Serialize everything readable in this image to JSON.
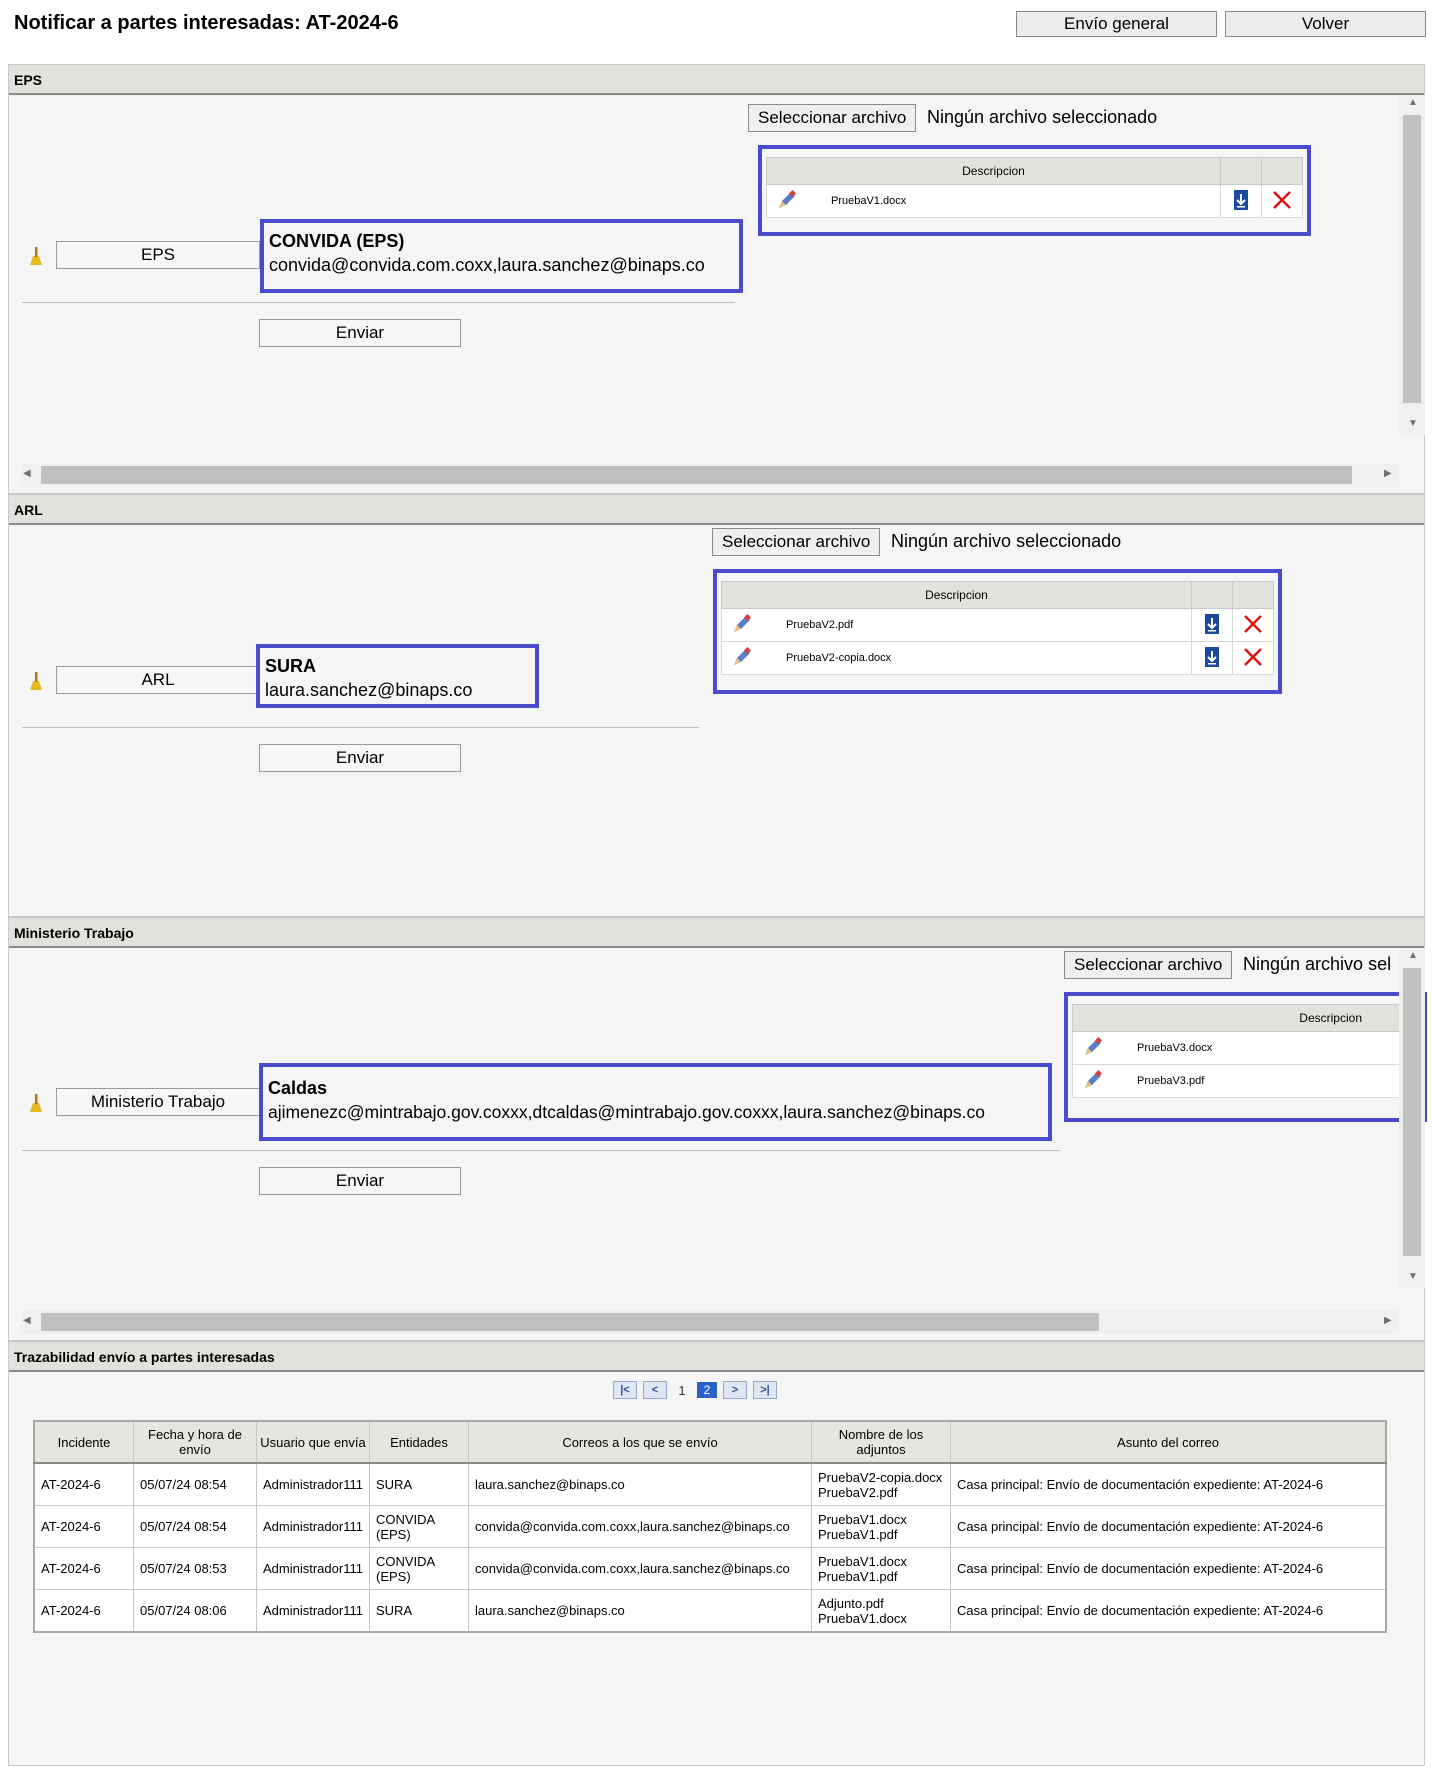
{
  "page": {
    "title": "Notificar a partes interesadas: AT-2024-6"
  },
  "toolbar": {
    "general_label": "Envío general",
    "back_label": "Volver"
  },
  "common": {
    "select_file_label": "Seleccionar archivo",
    "no_file_label": "Ningún archivo seleccionado",
    "no_file_truncated": "Ningún archivo sel",
    "send_label": "Enviar",
    "description_header": "Descripcion"
  },
  "sections": {
    "eps": {
      "header": "EPS",
      "entity_button": "EPS",
      "recipient_name": "CONVIDA (EPS)",
      "recipient_emails": "convida@convida.com.coxx,laura.sanchez@binaps.co",
      "files": [
        "PruebaV1.docx"
      ]
    },
    "arl": {
      "header": "ARL",
      "entity_button": "ARL",
      "recipient_name": "SURA",
      "recipient_emails": "laura.sanchez@binaps.co",
      "files": [
        "PruebaV2.pdf",
        "PruebaV2-copia.docx"
      ]
    },
    "ministerio": {
      "header": "Ministerio Trabajo",
      "entity_button": "Ministerio Trabajo",
      "recipient_name": "Caldas",
      "recipient_emails": "ajimenezc@mintrabajo.gov.coxxx,dtcaldas@mintrabajo.gov.coxxx,laura.sanchez@binaps.co",
      "files": [
        "PruebaV3.docx",
        "PruebaV3.pdf"
      ]
    }
  },
  "trace": {
    "header": "Trazabilidad envío a partes interesadas",
    "pager": {
      "page_1": "1",
      "page_2": "2"
    },
    "columns": [
      "Incidente",
      "Fecha y hora de envío",
      "Usuario que envía",
      "Entidades",
      "Correos a los que se envío",
      "Nombre de los adjuntos",
      "Asunto del correo"
    ],
    "rows": [
      [
        "AT-2024-6",
        "05/07/24 08:54",
        "Administrador111",
        "SURA",
        "laura.sanchez@binaps.co",
        "PruebaV2-copia.docx PruebaV2.pdf",
        "Casa principal: Envío de documentación expediente: AT-2024-6"
      ],
      [
        "AT-2024-6",
        "05/07/24 08:54",
        "Administrador111",
        "CONVIDA (EPS)",
        "convida@convida.com.coxx,laura.sanchez@binaps.co",
        "PruebaV1.docx PruebaV1.pdf",
        "Casa principal: Envío de documentación expediente: AT-2024-6"
      ],
      [
        "AT-2024-6",
        "05/07/24 08:53",
        "Administrador111",
        "CONVIDA (EPS)",
        "convida@convida.com.coxx,laura.sanchez@binaps.co",
        "PruebaV1.docx PruebaV1.pdf",
        "Casa principal: Envío de documentación expediente: AT-2024-6"
      ],
      [
        "AT-2024-6",
        "05/07/24 08:06",
        "Administrador111",
        "SURA",
        "laura.sanchez@binaps.co",
        "Adjunto.pdf PruebaV1.docx",
        "Casa principal: Envío de documentación expediente: AT-2024-6"
      ]
    ]
  },
  "colors": {
    "highlight": "#4a4acc",
    "delete": "#dd1111",
    "download": "#1a4a9a"
  },
  "icons": [
    "broom-icon",
    "pencil-icon",
    "download-icon",
    "delete-icon"
  ]
}
